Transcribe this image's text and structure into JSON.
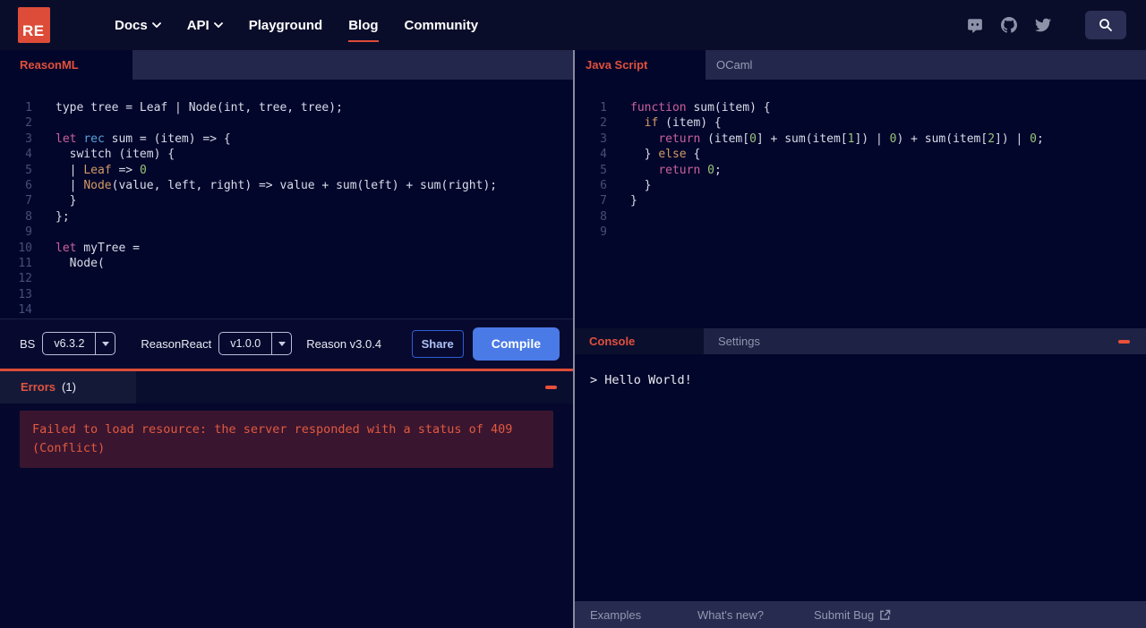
{
  "nav": {
    "logo_text": "RE",
    "items": [
      {
        "label": "Docs",
        "chevron": true,
        "active": false
      },
      {
        "label": "API",
        "chevron": true,
        "active": false
      },
      {
        "label": "Playground",
        "chevron": false,
        "active": false
      },
      {
        "label": "Blog",
        "chevron": false,
        "active": true
      },
      {
        "label": "Community",
        "chevron": false,
        "active": false
      }
    ],
    "icons": [
      "discord-icon",
      "github-icon",
      "twitter-icon",
      "search-icon"
    ]
  },
  "left": {
    "tab": "ReasonML",
    "editor": {
      "lines": [
        [
          [
            "plain",
            "type tree = Leaf | Node(int, tree, tree);"
          ]
        ],
        [],
        [
          [
            "kw",
            "let"
          ],
          [
            "plain",
            " "
          ],
          [
            "kw2",
            "rec"
          ],
          [
            "plain",
            " sum = (item) => {"
          ]
        ],
        [
          [
            "plain",
            "  switch (item) {"
          ]
        ],
        [
          [
            "plain",
            "  | "
          ],
          [
            "orange",
            "Leaf"
          ],
          [
            "plain",
            " => "
          ],
          [
            "num",
            "0"
          ]
        ],
        [
          [
            "plain",
            "  | "
          ],
          [
            "orange",
            "Node"
          ],
          [
            "plain",
            "(value, left, right) => value + sum(left) + sum(right);"
          ]
        ],
        [
          [
            "plain",
            "  }"
          ]
        ],
        [
          [
            "plain",
            "};"
          ]
        ],
        [],
        [
          [
            "kw",
            "let"
          ],
          [
            "plain",
            " myTree ="
          ]
        ],
        [
          [
            "plain",
            "  Node("
          ]
        ],
        [],
        [],
        [],
        [],
        [],
        [],
        []
      ]
    },
    "toolbar": {
      "bs_label": "BS",
      "bs_version": "v6.3.2",
      "reasonreact_label": "ReasonReact",
      "reasonreact_version": "v1.0.0",
      "reason_version": "Reason v3.0.4",
      "share_label": "Share",
      "compile_label": "Compile"
    },
    "errors": {
      "title": "Errors",
      "count": "(1)",
      "message": "Failed to load resource: the server responded with a status of 409 (Conflict)"
    }
  },
  "right": {
    "tabs": {
      "javascript": "Java Script",
      "ocaml": "OCaml"
    },
    "editor": {
      "lines": [
        [
          [
            "kw",
            "function"
          ],
          [
            "plain",
            " sum(item) {"
          ]
        ],
        [
          [
            "plain",
            "  "
          ],
          [
            "orange",
            "if"
          ],
          [
            "plain",
            " (item) {"
          ]
        ],
        [
          [
            "plain",
            "    "
          ],
          [
            "kw",
            "return"
          ],
          [
            "plain",
            " (item["
          ],
          [
            "num",
            "0"
          ],
          [
            "plain",
            "] + sum(item["
          ],
          [
            "num",
            "1"
          ],
          [
            "plain",
            "]) | "
          ],
          [
            "num",
            "0"
          ],
          [
            "plain",
            ") + sum(item["
          ],
          [
            "num",
            "2"
          ],
          [
            "plain",
            "]) | "
          ],
          [
            "num",
            "0"
          ],
          [
            "plain",
            ";"
          ]
        ],
        [
          [
            "plain",
            "  } "
          ],
          [
            "orange",
            "else"
          ],
          [
            "plain",
            " {"
          ]
        ],
        [
          [
            "plain",
            "    "
          ],
          [
            "kw",
            "return"
          ],
          [
            "plain",
            " "
          ],
          [
            "num",
            "0"
          ],
          [
            "plain",
            ";"
          ]
        ],
        [
          [
            "plain",
            "  }"
          ]
        ],
        [
          [
            "plain",
            "}"
          ]
        ],
        [],
        []
      ]
    },
    "console": {
      "tab_console": "Console",
      "tab_settings": "Settings",
      "output": "> Hello World!"
    },
    "footer": {
      "examples": "Examples",
      "whats_new": "What's new?",
      "submit_bug": "Submit Bug"
    }
  },
  "colors": {
    "accent_red": "#dd4c38",
    "compile_blue": "#4a7ae6",
    "background": "#03062b",
    "tabbar": "#23274b",
    "error_box_bg": "#3a1530",
    "error_text": "#e05a3d",
    "keyword_pink": "#c9619c",
    "keyword_blue": "#56a2d8",
    "constructor_orange": "#d19a66",
    "number_green": "#98c379"
  }
}
